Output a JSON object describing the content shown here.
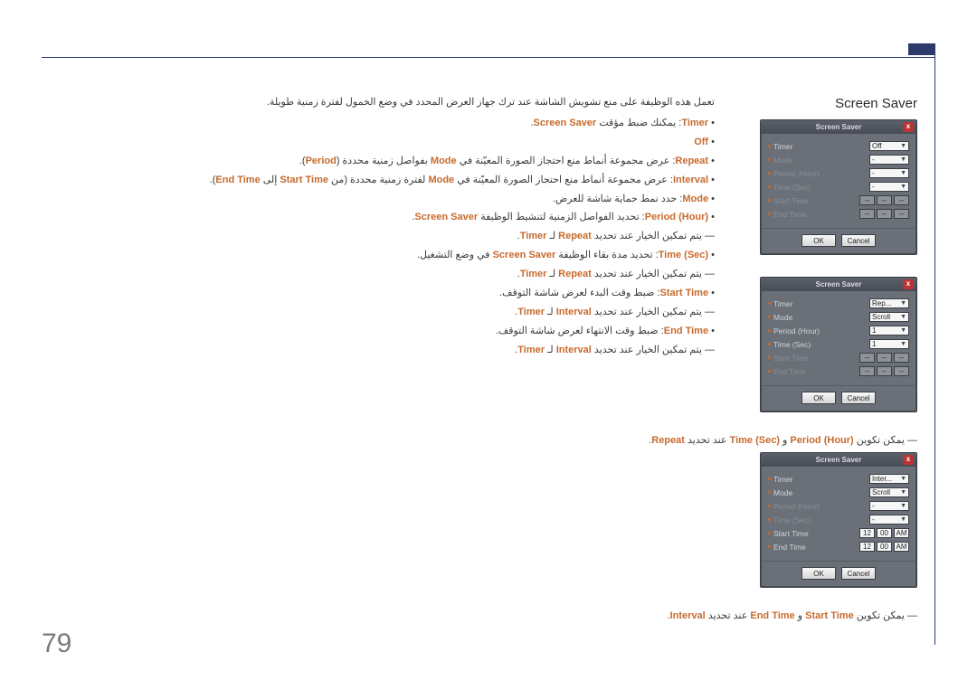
{
  "page": {
    "number": "79",
    "title": "Screen Saver"
  },
  "intro": "تعمل هذه الوظيفة على منع تشويش الشاشة عند ترك جهاز العرض المحدد في وضع الخمول لفترة زمنية طويلة.",
  "line_timer": {
    "k1": "Timer",
    "t1": ": يمكنك ضبط مؤقت ",
    "k2": "Screen Saver",
    "t2": "."
  },
  "off_label": "Off",
  "repeat": {
    "k1": "Repeat",
    "t1": ": عرض مجموعة أنماط منع احتجاز الصورة المعيّنة في ",
    "k2": "Mode",
    "t2": " بفواصل زمنية محددة (",
    "k3": "Period",
    "t3": ")."
  },
  "interval": {
    "k1": "Interval",
    "t1": ": عرض مجموعة أنماط منع احتجاز الصورة المعيّنة في ",
    "k2": "Mode",
    "t2": " لفترة زمنية محددة (من ",
    "k3": "Start Time",
    "t3": " إلى ",
    "k4": "End Time",
    "t4": ")."
  },
  "mode": {
    "k1": "Mode",
    "t1": ": حدد نمط حماية شاشة للعرض."
  },
  "period_hour": {
    "k1": "Period (Hour)",
    "t1": ": تحديد الفواصل الزمنية لتنشيط الوظيفة ",
    "k2": "Screen Saver",
    "t2": ".",
    "sub_pre": "― يتم تمكين الخيار عند تحديد ",
    "sub_k1": "Repeat",
    "sub_mid": " لـ ",
    "sub_k2": "Timer",
    "sub_end": "."
  },
  "time_sec": {
    "k1": "Time (Sec)",
    "t1": ": تحديد مدة بقاء الوظيفة ",
    "k2": "Screen Saver",
    "t2": " في وضع التشغيل.",
    "sub_pre": "― يتم تمكين الخيار عند تحديد ",
    "sub_k1": "Repeat",
    "sub_mid": " لـ ",
    "sub_k2": "Timer",
    "sub_end": "."
  },
  "start_time": {
    "k1": "Start Time",
    "t1": ": ضبط وقت البدء لعرض شاشة التوقف.",
    "sub_pre": "― يتم تمكين الخيار عند تحديد ",
    "sub_k1": "Interval",
    "sub_mid": " لـ ",
    "sub_k2": "Timer",
    "sub_end": "."
  },
  "end_time": {
    "k1": "End Time",
    "t1": ": ضبط وقت الانتهاء لعرض شاشة التوقف.",
    "sub_pre": "― يتم تمكين الخيار عند تحديد ",
    "sub_k1": "Interval",
    "sub_mid": " لـ ",
    "sub_k2": "Timer",
    "sub_end": "."
  },
  "note1": {
    "pre": "― يمكن تكوين ",
    "k1": "Period (Hour)",
    "mid": " و ",
    "k2": "Time (Sec)",
    "mid2": " عند تحديد ",
    "k3": "Repeat",
    "end": "."
  },
  "note2": {
    "pre": "― يمكن تكوين ",
    "k1": "Start Time",
    "mid": " و ",
    "k2": "End Time",
    "mid2": " عند تحديد ",
    "k3": "Interval",
    "end": "."
  },
  "dialog": {
    "title": "Screen Saver",
    "close": "x",
    "labels": {
      "timer": "Timer",
      "mode": "Mode",
      "period": "Period (Hour)",
      "timesec": "Time (Sec)",
      "start": "Start Time",
      "end": "End Time"
    },
    "ok": "OK",
    "cancel": "Cancel",
    "d1": {
      "timer_val": "Off",
      "mode_val": "-",
      "period_val": "-",
      "timesec_val": "-",
      "st_h": "--",
      "st_m": "--",
      "st_a": "--",
      "et_h": "--",
      "et_m": "--",
      "et_a": "--"
    },
    "d2": {
      "timer_val": "Rep...",
      "mode_val": "Scroll",
      "period_val": "1",
      "timesec_val": "1",
      "st_h": "--",
      "st_m": "--",
      "st_a": "--",
      "et_h": "--",
      "et_m": "--",
      "et_a": "--"
    },
    "d3": {
      "timer_val": "Inter...",
      "mode_val": "Scroll",
      "period_val": "-",
      "timesec_val": "-",
      "st_h": "12",
      "st_m": "00",
      "st_a": "AM",
      "et_h": "12",
      "et_m": "00",
      "et_a": "AM"
    }
  }
}
